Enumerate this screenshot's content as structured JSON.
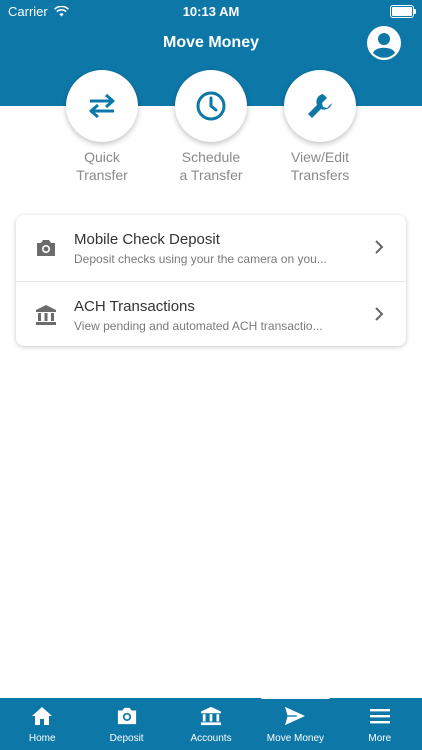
{
  "status": {
    "carrier": "Carrier",
    "time": "10:13 AM"
  },
  "header": {
    "title": "Move Money"
  },
  "quick_actions": [
    {
      "label": "Quick\nTransfer",
      "icon": "swap-arrows-icon"
    },
    {
      "label": "Schedule\na Transfer",
      "icon": "clock-icon"
    },
    {
      "label": "View/Edit\nTransfers",
      "icon": "wrench-icon"
    }
  ],
  "list": [
    {
      "title": "Mobile Check Deposit",
      "subtitle": "Deposit checks using your the camera on you...",
      "icon": "camera-icon"
    },
    {
      "title": "ACH Transactions",
      "subtitle": "View pending and automated ACH transactio...",
      "icon": "bank-icon"
    }
  ],
  "tabs": [
    {
      "label": "Home",
      "icon": "home-icon"
    },
    {
      "label": "Deposit",
      "icon": "camera-icon"
    },
    {
      "label": "Accounts",
      "icon": "bank-icon"
    },
    {
      "label": "Move Money",
      "icon": "paper-plane-icon"
    },
    {
      "label": "More",
      "icon": "menu-icon"
    }
  ],
  "colors": {
    "brand": "#0d78a8",
    "icon_gray": "#6b6b6b",
    "label_gray": "#8a8a8a"
  }
}
